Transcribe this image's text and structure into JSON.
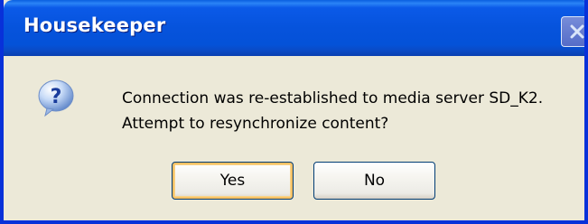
{
  "window": {
    "title": "Housekeeper",
    "close_icon": "close-icon"
  },
  "message": {
    "icon": "question-icon",
    "line1": "Connection was re-established to media server SD_K2.",
    "line2": "Attempt to resynchronize content?"
  },
  "buttons": {
    "yes_label": "Yes",
    "no_label": "No"
  },
  "colors": {
    "titlebar": "#0653dc",
    "frame": "#0831d9",
    "dialog_bg": "#ece9d8",
    "default_button_focus": "#f7c164"
  }
}
